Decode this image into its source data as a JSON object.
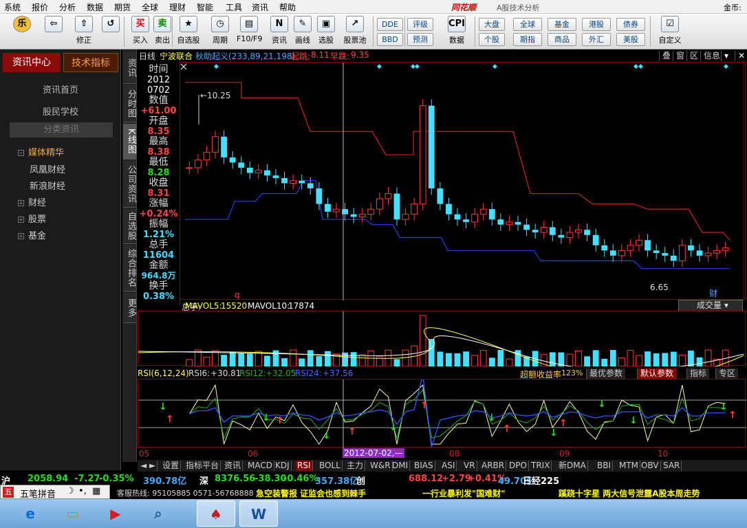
{
  "menu": [
    "系统",
    "报价",
    "分析",
    "数据",
    "期货",
    "全球",
    "理财",
    "智能",
    "工具",
    "资讯",
    "帮助"
  ],
  "brand": "同花顺",
  "brand_sub": "A股技术分析",
  "menu_right": "金币:",
  "toolbar": {
    "buttons": [
      {
        "label": "",
        "icon": "乐"
      },
      {
        "label": "",
        "icon": "⇦"
      },
      {
        "label": "修正",
        "icon": "⇧"
      },
      {
        "label": "",
        "icon": "↺"
      },
      {
        "label": "买入",
        "icon": "买"
      },
      {
        "label": "卖出",
        "icon": "卖"
      },
      {
        "label": "自选股",
        "icon": "★"
      },
      {
        "label": "周期",
        "icon": "◷"
      },
      {
        "label": "F10/F9",
        "icon": "▤"
      },
      {
        "label": "资讯",
        "icon": "N"
      },
      {
        "label": "画线",
        "icon": "✎"
      },
      {
        "label": "选股",
        "icon": "▣"
      },
      {
        "label": "股票池",
        "icon": "↗"
      },
      {
        "label": "数据",
        "icon": "CPI"
      },
      {
        "label": "自定义",
        "icon": "☑"
      }
    ],
    "small_buttons": [
      "DDE",
      "BBD",
      "评级",
      "预测",
      "大盘",
      "个股",
      "全球",
      "期指",
      "基金",
      "商品",
      "港股",
      "外汇",
      "债券",
      "美股"
    ]
  },
  "left_panel": {
    "tab_active": "资讯中心",
    "tab_other": "技术指标",
    "links": [
      "资讯首页",
      "股民学校"
    ],
    "category": "分类资讯",
    "tree": [
      {
        "label": "媒体精华",
        "open": true,
        "active": true
      },
      {
        "label": "凤凰财经",
        "child": true
      },
      {
        "label": "新浪财经",
        "child": true
      },
      {
        "label": "财经"
      },
      {
        "label": "股票"
      },
      {
        "label": "基金"
      }
    ]
  },
  "vtabs": [
    "资讯",
    "分时图",
    "K线图",
    "公司资讯",
    "自选股",
    "综合排名",
    "更多"
  ],
  "chart_header": {
    "period": "日线",
    "stock": "宁波联合",
    "indicator": "秋助起义(233,89,21,198)",
    "start_label": "起跳:",
    "start_val": "8.11",
    "drop_label": "早跌:",
    "drop_val": "9.35",
    "right_buttons": [
      "叠",
      "窗",
      "区",
      "信息"
    ]
  },
  "info": {
    "time_label": "时间",
    "date_year": "2012",
    "date_md": "0702",
    "value_label": "数值",
    "value": "+61.00",
    "open_label": "开盘",
    "open": "8.35",
    "high_label": "最高",
    "high": "8.38",
    "low_label": "最低",
    "low": "8.28",
    "close_label": "收盘",
    "close": "8.31",
    "chg_label": "涨幅",
    "chg": "+0.24%",
    "amp_label": "振幅",
    "amp": "1.21%",
    "vol_label": "总手",
    "vol": "11604",
    "amt_label": "金额",
    "amt": "964.8万",
    "turn_label": "换手",
    "turn": "0.38%"
  },
  "chart_labels": {
    "max_price": "10.25",
    "min_price": "6.65",
    "mark": "财",
    "q": "q"
  },
  "volume": {
    "title_prefix": "总手:",
    "title_val": "11604",
    "ma5_label": "MAVOL5:",
    "ma5": "15520",
    "ma10_label": "MAVOL10:",
    "ma10": "17874",
    "dropdown": "成交量"
  },
  "rsi": {
    "title": "RSI(6,12,24)",
    "rsi6_label": "RSI6:",
    "rsi6": "+30.81",
    "rsi12_label": "RSI12:",
    "rsi12": "+32.05",
    "rsi24_label": "RSI24:",
    "rsi24": "+37.56",
    "excess": "超额收益率",
    "excess_val": "123%",
    "buttons": [
      "最优参数",
      "默认参数",
      "指标",
      "专区"
    ]
  },
  "date_axis": [
    "05",
    "06",
    "07",
    "08",
    "09",
    "10"
  ],
  "cursor_date": "2012-07-02,—",
  "bottom_tabs": [
    "设置",
    "指标平台",
    "资讯",
    "MACD",
    "KDJ",
    "RSI",
    "BOLL",
    "主力",
    "W&R",
    "DMI",
    "BIAS",
    "ASI",
    "VR",
    "ARBR",
    "DPO",
    "TRIX",
    "新DMA",
    "BBI",
    "MTM",
    "OBV",
    "SAR"
  ],
  "active_bottom_tab": "RSI",
  "ticker": [
    {
      "t": "沪",
      "c": "#fff"
    },
    {
      "t": "2058.94",
      "c": "#22dd22"
    },
    {
      "t": "-7.27",
      "c": "#22dd22"
    },
    {
      "t": "-0.35%",
      "c": "#22dd22"
    },
    {
      "t": "390.78亿",
      "c": "#44aaff"
    },
    {
      "t": "深",
      "c": "#fff"
    },
    {
      "t": "8376.56",
      "c": "#22dd22"
    },
    {
      "t": "-38.30",
      "c": "#22dd22"
    },
    {
      "t": "-0.46%",
      "c": "#22dd22"
    },
    {
      "t": "357.38亿",
      "c": "#44aaff"
    },
    {
      "t": "创",
      "c": "#fff"
    },
    {
      "t": "688.12",
      "c": "#ff4444"
    },
    {
      "t": "+2.79",
      "c": "#ff4444"
    },
    {
      "t": "+0.41%",
      "c": "#ff4444"
    },
    {
      "t": "49.70亿",
      "c": "#44aaff"
    },
    {
      "t": "日经225",
      "c": "#fff"
    }
  ],
  "news": {
    "hotline": "客服热线: 95105885 0571-56768888",
    "items": [
      "急空装警报 证监会也感到棘手",
      "一行业暴利发\"国难财\"",
      "蹊跷十字星 两大信号泄露A股本周走势"
    ]
  },
  "ime": {
    "label": "五笔拼音"
  },
  "taskbar": [
    {
      "name": "ie-icon",
      "glyph": "e"
    },
    {
      "name": "folder-icon",
      "glyph": "▭"
    },
    {
      "name": "media-icon",
      "glyph": "▶"
    },
    {
      "name": "search-app-icon",
      "glyph": "⌕"
    },
    {
      "name": "cards-icon",
      "glyph": "♠"
    },
    {
      "name": "word-icon",
      "glyph": "W"
    }
  ],
  "chart_data": {
    "type": "candlestick",
    "close_prices": [
      8.6,
      8.75,
      8.9,
      9.2,
      8.8,
      8.7,
      8.6,
      8.5,
      8.55,
      8.45,
      8.4,
      8.3,
      8.35,
      8.3,
      8.2,
      7.9,
      7.75,
      7.8,
      7.7,
      7.65,
      7.7,
      7.8,
      8.0,
      8.1,
      7.6,
      7.7,
      7.9,
      9.8,
      8.2,
      7.9,
      7.7,
      7.6,
      7.55,
      7.7,
      7.8,
      7.6,
      7.5,
      7.55,
      7.5,
      7.4,
      7.35,
      7.45,
      7.3,
      7.25,
      7.35,
      7.4,
      7.3,
      7.1,
      7.0,
      6.9,
      7.0,
      7.1,
      7.2,
      7.0,
      6.95,
      6.9,
      6.8,
      7.1,
      7.0,
      6.9,
      6.95,
      7.0,
      7.05
    ],
    "max_price": 10.25,
    "min_price": 6.65
  }
}
